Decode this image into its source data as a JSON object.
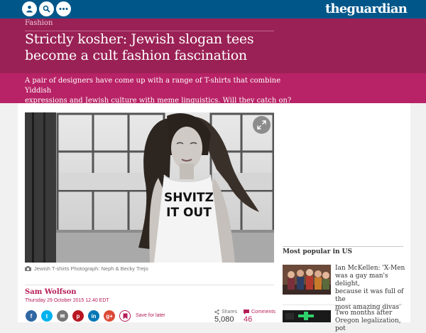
{
  "topbar": {
    "icons": [
      "profile-icon",
      "search-icon",
      "more-icon"
    ],
    "logo_the": "the",
    "logo_guardian": "guardian",
    "brand_color": "#005689"
  },
  "article": {
    "section": "Fashion",
    "headline_line1": "Strictly kosher: Jewish slogan tees",
    "headline_line2": "become a cult fashion fascination",
    "standfirst_line1": "A pair of designers have come up with a range of T-shirts that combine Yiddish",
    "standfirst_line2": "expressions and Jewish culture with meme linguistics. Will they catch on?",
    "shirt_line1": "SHVITZ",
    "shirt_line2": "IT OUT",
    "caption": "Jewish T-shirts Photograph: Neph & Becky Trejo",
    "author": "Sam Wolfson",
    "date": "Thursday 29 October 2015 12.40 EDT",
    "accent_color": "#b51c57"
  },
  "share": {
    "buttons": [
      {
        "name": "facebook",
        "glyph": "f",
        "color": "#3067a3"
      },
      {
        "name": "twitter",
        "glyph": "t",
        "color": "#03b3ee"
      },
      {
        "name": "email",
        "glyph": "✉",
        "color": "#767676"
      },
      {
        "name": "pinterest",
        "glyph": "p",
        "color": "#b81621"
      },
      {
        "name": "linkedin",
        "glyph": "in",
        "color": "#0077b5"
      },
      {
        "name": "googleplus",
        "glyph": "g+",
        "color": "#dc4a38"
      }
    ],
    "save_label": "Save for later",
    "shares_label": "Shares",
    "shares_value": "5,080",
    "comments_label": "Comments",
    "comments_value": "46"
  },
  "most_popular": {
    "title": "Most popular in US",
    "items": [
      {
        "line1": "Ian McKellen: 'X-Men",
        "line2": "was a gay man's delight,",
        "line3": "because it was full of the",
        "line4": "most amazing divas'"
      },
      {
        "line1": "Two months after",
        "line2": "Oregon legalization, pot"
      }
    ]
  }
}
